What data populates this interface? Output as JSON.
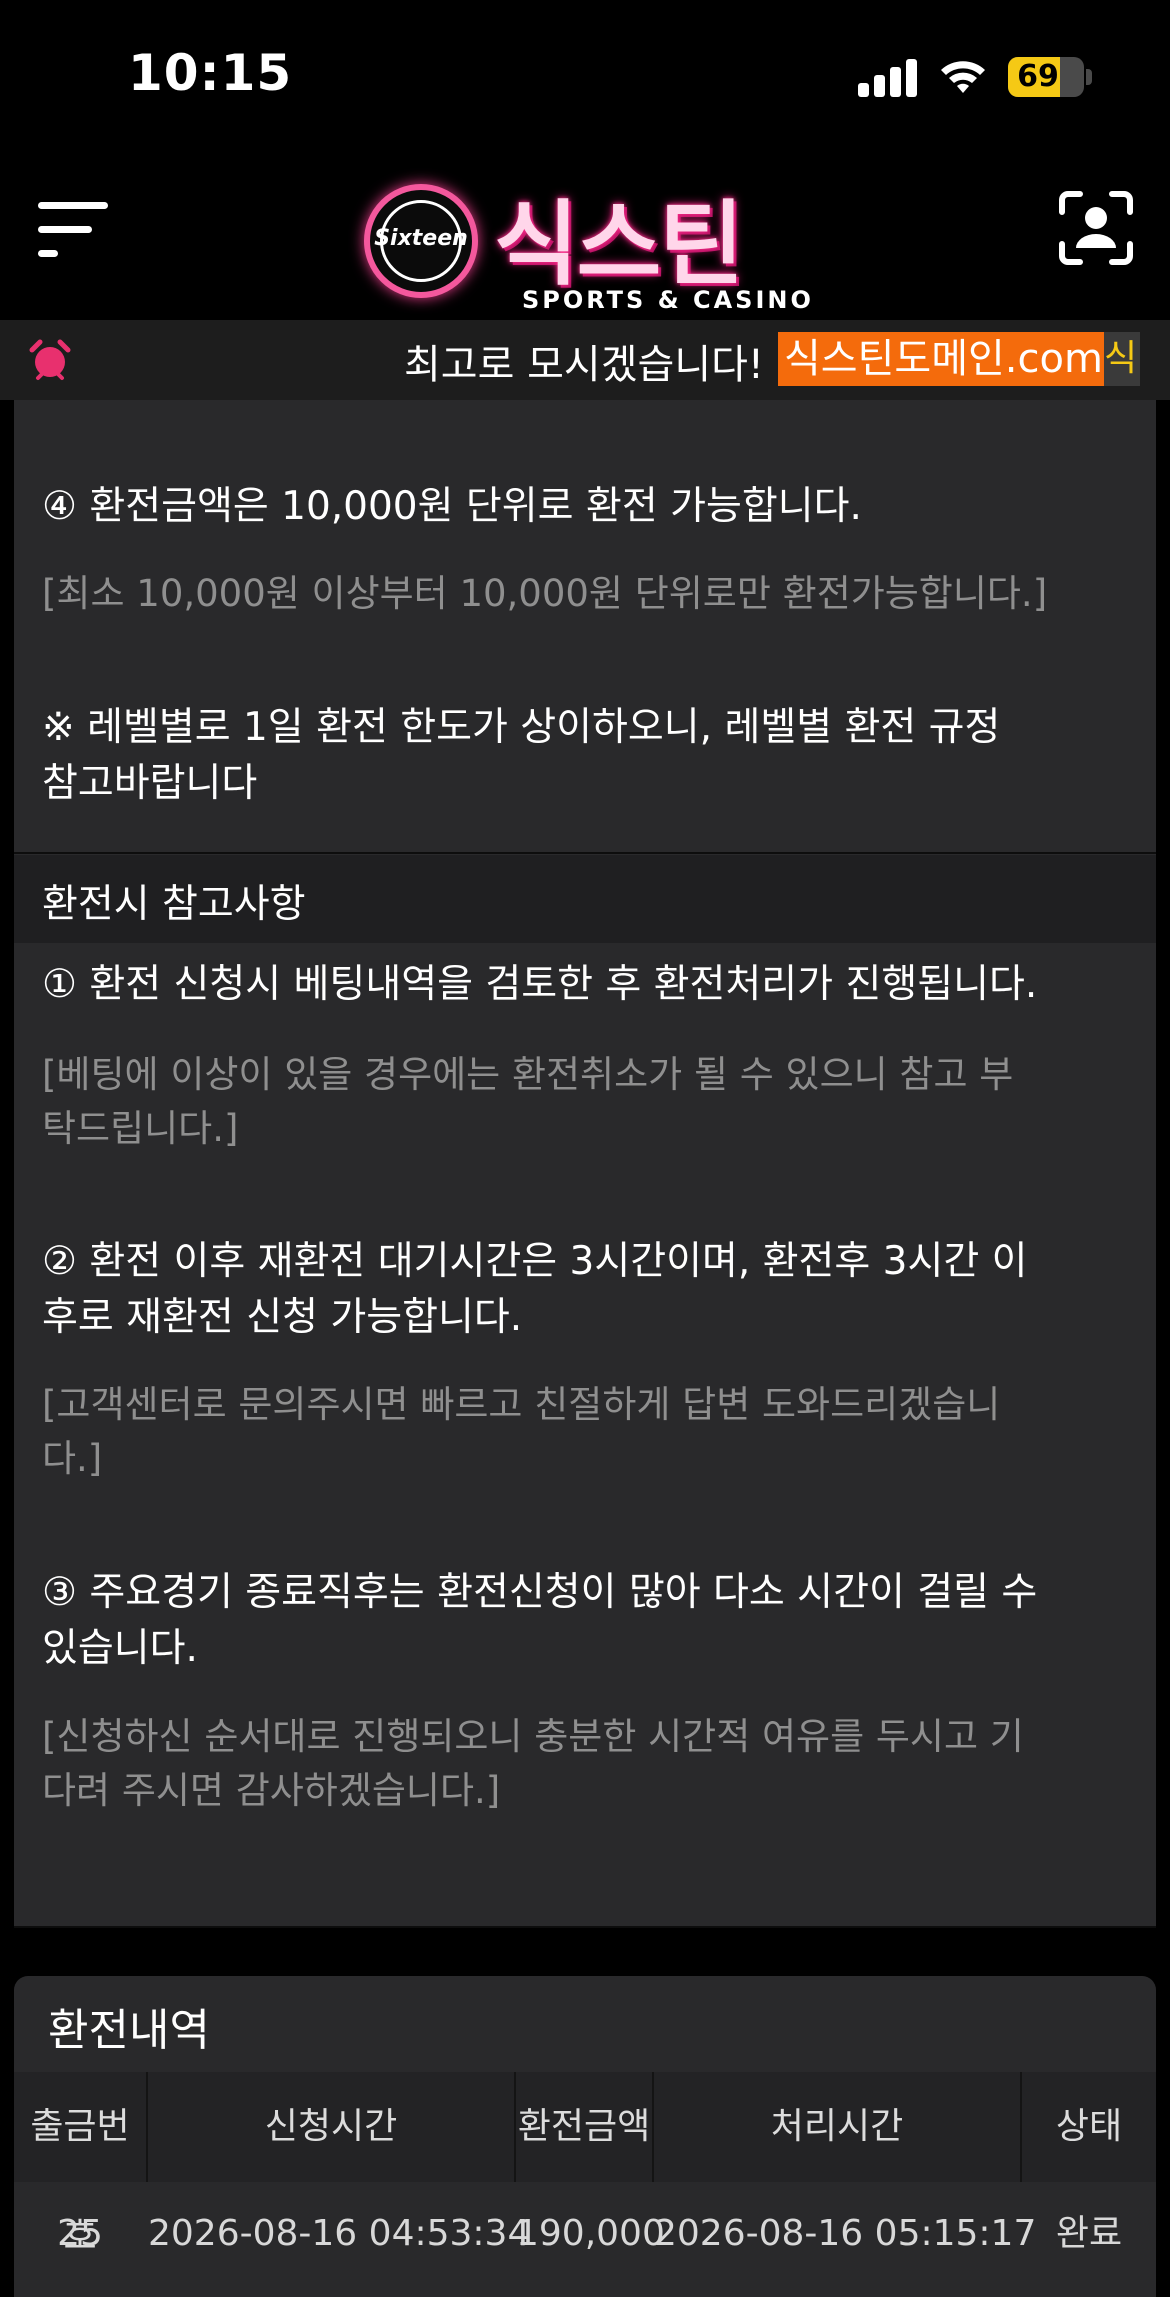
{
  "status_bar": {
    "time": "10:15",
    "battery": "69",
    "battery_level": 0.69
  },
  "header": {
    "logo_badge": "Sixteen",
    "logo_title": "식스틴",
    "logo_subtitle": "SPORTS & CASINO"
  },
  "ticker": {
    "text": "최고로 모시겠습니다!",
    "highlight": "식스틴도메인.com",
    "trailing": "식"
  },
  "notice": {
    "item4_title": "④ 환전금액은 10,000원 단위로 환전 가능합니다.",
    "item4_note": "[최소 10,000원 이상부터 10,000원 단위로만 환전가능합니다.]",
    "level_line1": "※ 레벨별로 1일 환전 한도가 상이하오니, 레벨별 환전 규정",
    "level_line2": "참고바랍니다",
    "section_title": "환전시 참고사항",
    "item1_title": "① 환전 신청시 베팅내역을 검토한 후 환전처리가 진행됩니다.",
    "item1_note1": "[베팅에 이상이 있을 경우에는 환전취소가 될 수 있으니 참고 부",
    "item1_note2": "탁드립니다.]",
    "item2_title1": "② 환전 이후 재환전 대기시간은 3시간이며, 환전후 3시간 이",
    "item2_title2": "후로 재환전 신청 가능합니다.",
    "item2_note1": "[고객센터로 문의주시면 빠르고 친절하게 답변 도와드리겠습니",
    "item2_note2": "다.]",
    "item3_title1": "③ 주요경기 종료직후는 환전신청이 많아 다소 시간이 걸릴 수",
    "item3_title2": "있습니다.",
    "item3_note1": "[신청하신 순서대로 진행되오니 충분한 시간적 여유를 두시고 기",
    "item3_note2": "다려 주시면 감사하겠습니다.]"
  },
  "history": {
    "title": "환전내역",
    "columns": [
      "출금번호",
      "신청시간",
      "환전금액",
      "처리시간",
      "상태"
    ],
    "rows": [
      {
        "id": "25",
        "requested": "2026-08-16 04:53:34",
        "amount": "190,000",
        "processed": "2026-08-16 05:15:17",
        "status": "완료"
      }
    ]
  }
}
